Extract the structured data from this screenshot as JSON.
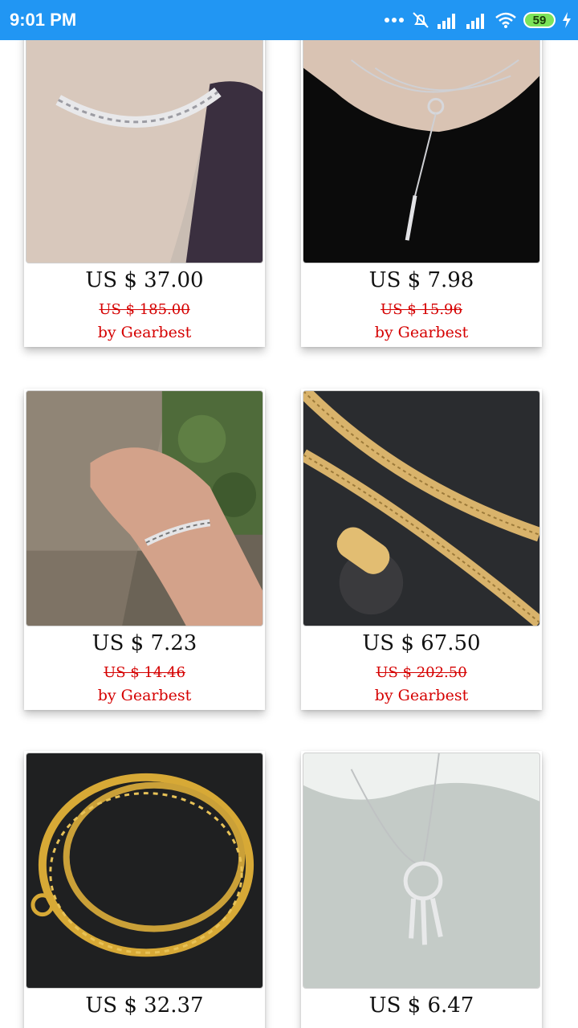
{
  "status_bar": {
    "time": "9:01 PM",
    "battery": "59"
  },
  "products": [
    {
      "price": "US $ 37.00",
      "old_price": "US $ 185.00",
      "seller": "by Gearbest",
      "image": "silver-cuban-choker"
    },
    {
      "price": "US $ 7.98",
      "old_price": "US $ 15.96",
      "seller": "by Gearbest",
      "image": "silver-lariat-necklace"
    },
    {
      "price": "US $ 7.23",
      "old_price": "US $ 14.46",
      "seller": "by Gearbest",
      "image": "silver-chain-bracelet"
    },
    {
      "price": "US $ 67.50",
      "old_price": "US $ 202.50",
      "seller": "by Gearbest",
      "image": "gold-18k-chain"
    },
    {
      "price": "US $ 32.37",
      "old_price": "",
      "seller": "",
      "image": "gold-rope-chain"
    },
    {
      "price": "US $ 6.47",
      "old_price": "",
      "seller": "",
      "image": "dreamcatcher-pendant"
    }
  ],
  "colors": {
    "status_bar": "#2196F3",
    "sale_red": "#d50000"
  }
}
